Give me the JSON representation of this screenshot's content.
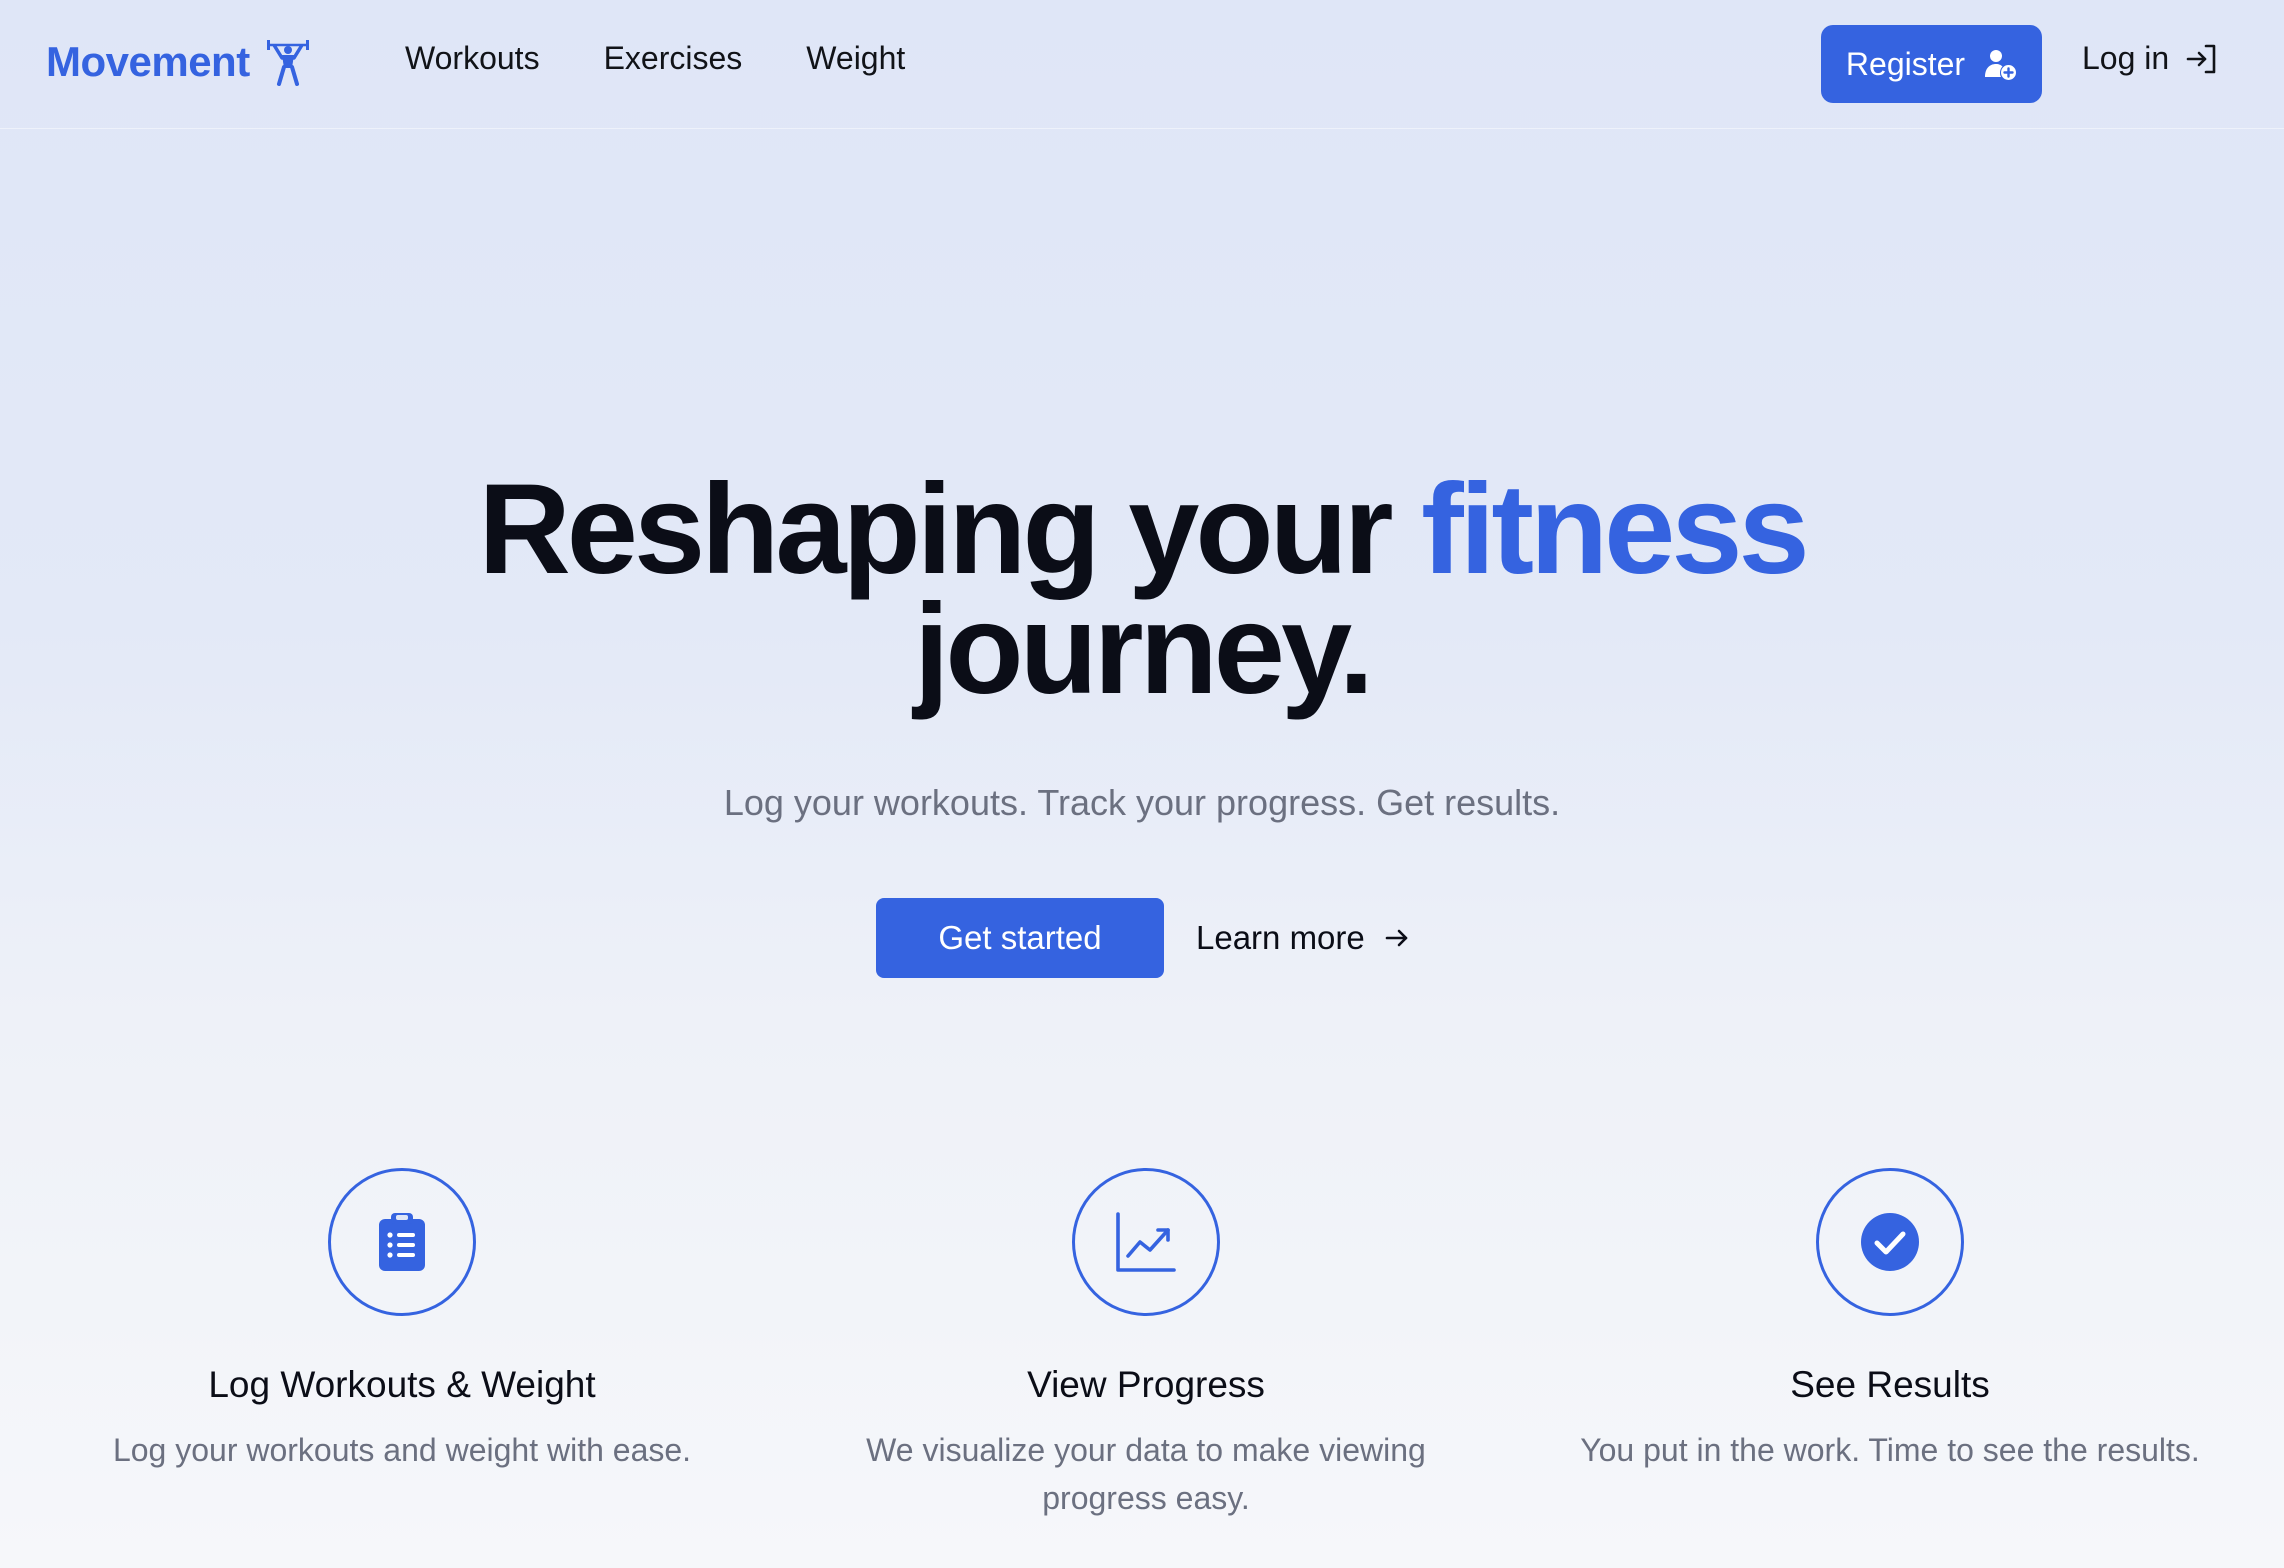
{
  "brand": {
    "name": "Movement",
    "icon": "weightlifter-icon",
    "color": "#3563e0"
  },
  "nav": {
    "items": [
      {
        "label": "Workouts"
      },
      {
        "label": "Exercises"
      },
      {
        "label": "Weight"
      }
    ]
  },
  "auth": {
    "register_label": "Register",
    "register_icon": "user-plus-icon",
    "login_label": "Log in",
    "login_icon": "login-arrow-icon"
  },
  "hero": {
    "title_part1": "Reshaping your ",
    "title_accent": "fitness",
    "title_part2": "journey.",
    "subtitle": "Log your workouts. Track your progress. Get results.",
    "primary_cta": "Get started",
    "secondary_cta": "Learn more",
    "secondary_cta_icon": "arrow-right-icon"
  },
  "features": [
    {
      "icon": "clipboard-list-icon",
      "title": "Log Workouts & Weight",
      "description": "Log your workouts and weight with ease."
    },
    {
      "icon": "chart-trend-icon",
      "title": "View Progress",
      "description": "We visualize your data to make viewing progress easy."
    },
    {
      "icon": "check-circle-icon",
      "title": "See Results",
      "description": "You put in the work. Time to see the results."
    }
  ],
  "colors": {
    "accent": "#3563e0",
    "text": "#0b0d17",
    "muted": "#6b7080"
  }
}
